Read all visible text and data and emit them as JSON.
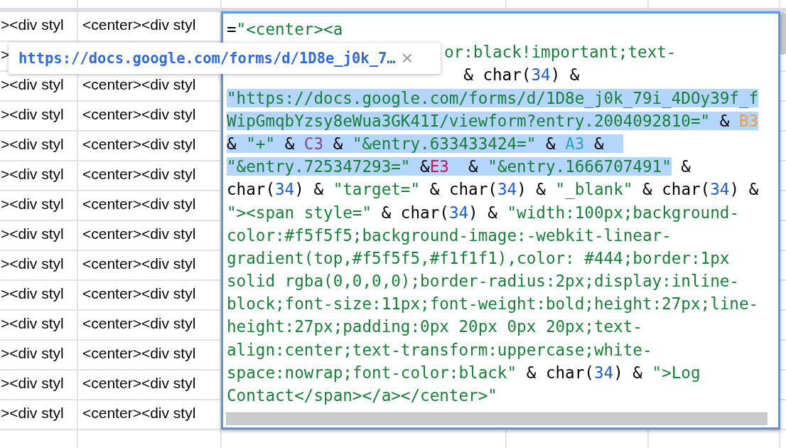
{
  "sheet": {
    "rows": [
      {
        "cells": [
          "><div styl",
          "<center><div styl"
        ]
      },
      {
        "cells": [
          ">"
        ]
      },
      {
        "cells": [
          "><div styl",
          "<center><div styl"
        ]
      },
      {
        "cells": [
          "><div styl",
          "<center><div styl"
        ]
      },
      {
        "cells": [
          "><div styl",
          "<center><div styl"
        ]
      },
      {
        "cells": [
          "><div styl",
          "<center><div styl"
        ]
      },
      {
        "cells": [
          "><div styl",
          "<center><div styl"
        ]
      },
      {
        "cells": [
          "><div styl",
          "<center><div styl"
        ]
      },
      {
        "cells": [
          "><div styl",
          "<center><div styl"
        ]
      },
      {
        "cells": [
          "><div styl",
          "<center><div styl"
        ]
      },
      {
        "cells": [
          "><div styl",
          "<center><div styl"
        ]
      },
      {
        "cells": [
          "><div styl",
          "<center><div styl"
        ]
      },
      {
        "cells": [
          "><div styl",
          "<center><div styl"
        ]
      },
      {
        "cells": [
          "><div styl",
          "<center><div styl"
        ]
      }
    ]
  },
  "editor": {
    "lines": [
      {
        "kind": "full",
        "tokens": [
          {
            "kind": "op",
            "text": "=",
            "selected": false
          },
          {
            "kind": "string",
            "text": "\"<center><a",
            "selected": false
          }
        ]
      },
      {
        "kind": "partial",
        "tokens": [
          {
            "kind": "string",
            "text": "or:black!important;text-",
            "selected": false
          }
        ]
      },
      {
        "kind": "partial",
        "tokens": [
          {
            "kind": "op",
            "text": "  & char(",
            "selected": false
          },
          {
            "kind": "number",
            "text": "34",
            "selected": false
          },
          {
            "kind": "op",
            "text": ") &",
            "selected": false
          }
        ]
      },
      {
        "kind": "full",
        "tokens": [
          {
            "kind": "string",
            "text": "\"https://docs.google.com/forms/d/1D8e_j0k_79i_4DOy39f_f",
            "selected": true
          }
        ]
      },
      {
        "kind": "full",
        "tokens": [
          {
            "kind": "string",
            "text": "WipGmqbYzsy8eWua3GK41I/viewform?entry.2004092810=\"",
            "selected": true
          },
          {
            "kind": "op",
            "text": " & ",
            "selected": true
          },
          {
            "kind": "ref",
            "text": "B3",
            "color": "#f29b35",
            "selected": true
          }
        ]
      },
      {
        "kind": "full",
        "tokens": [
          {
            "kind": "op",
            "text": "& ",
            "selected": true
          },
          {
            "kind": "string",
            "text": "\"+\"",
            "selected": true
          },
          {
            "kind": "op",
            "text": " & ",
            "selected": true
          },
          {
            "kind": "ref",
            "text": "C3",
            "color": "#7e4a8c",
            "selected": true
          },
          {
            "kind": "op",
            "text": " & ",
            "selected": true
          },
          {
            "kind": "string",
            "text": "\"&entry.633433424=\"",
            "selected": true
          },
          {
            "kind": "op",
            "text": " & ",
            "selected": true
          },
          {
            "kind": "ref",
            "text": "A3",
            "color": "#26a5c9",
            "selected": true
          },
          {
            "kind": "op",
            "text": " &  ",
            "selected": true
          }
        ]
      },
      {
        "kind": "full",
        "tokens": [
          {
            "kind": "string",
            "text": "\"&entry.725347293=\"",
            "selected": true
          },
          {
            "kind": "op",
            "text": " &",
            "selected": true
          },
          {
            "kind": "ref",
            "text": "E3",
            "color": "#c2185b",
            "selected": true
          },
          {
            "kind": "op",
            "text": "  & ",
            "selected": true
          },
          {
            "kind": "string",
            "text": "\"&entry.1666707491\"",
            "selected": true
          },
          {
            "kind": "op",
            "text": " &",
            "selected": false
          }
        ]
      },
      {
        "kind": "full",
        "tokens": [
          {
            "kind": "op",
            "text": "char(",
            "selected": false
          },
          {
            "kind": "number",
            "text": "34",
            "selected": false
          },
          {
            "kind": "op",
            "text": ") & ",
            "selected": false
          },
          {
            "kind": "string",
            "text": "\"target=\"",
            "selected": false
          },
          {
            "kind": "op",
            "text": " & char(",
            "selected": false
          },
          {
            "kind": "number",
            "text": "34",
            "selected": false
          },
          {
            "kind": "op",
            "text": ") & ",
            "selected": false
          },
          {
            "kind": "string",
            "text": "\"_blank\"",
            "selected": false
          },
          {
            "kind": "op",
            "text": " & char(",
            "selected": false
          },
          {
            "kind": "number",
            "text": "34",
            "selected": false
          },
          {
            "kind": "op",
            "text": ") &",
            "selected": false
          }
        ]
      },
      {
        "kind": "full",
        "tokens": [
          {
            "kind": "string",
            "text": "\"><span style=\"",
            "selected": false
          },
          {
            "kind": "op",
            "text": " & char(",
            "selected": false
          },
          {
            "kind": "number",
            "text": "34",
            "selected": false
          },
          {
            "kind": "op",
            "text": ") & ",
            "selected": false
          },
          {
            "kind": "string",
            "text": "\"width:100px;background-",
            "selected": false
          }
        ]
      },
      {
        "kind": "full",
        "tokens": [
          {
            "kind": "string",
            "text": "color:#f5f5f5;background-image:-webkit-linear-",
            "selected": false
          }
        ]
      },
      {
        "kind": "full",
        "tokens": [
          {
            "kind": "string",
            "text": "gradient(top,#f5f5f5,#f1f1f1),color: #444;border:1px",
            "selected": false
          }
        ]
      },
      {
        "kind": "full",
        "tokens": [
          {
            "kind": "string",
            "text": "solid rgba(0,0,0,0);border-radius:2px;display:inline-",
            "selected": false
          }
        ]
      },
      {
        "kind": "full",
        "tokens": [
          {
            "kind": "string",
            "text": "block;font-size:11px;font-weight:bold;height:27px;line-",
            "selected": false
          }
        ]
      },
      {
        "kind": "full",
        "tokens": [
          {
            "kind": "string",
            "text": "height:27px;padding:0px 20px 0px 20px;text-",
            "selected": false
          }
        ]
      },
      {
        "kind": "full",
        "tokens": [
          {
            "kind": "string",
            "text": "align:center;text-transform:uppercase;white-",
            "selected": false
          }
        ]
      },
      {
        "kind": "full",
        "tokens": [
          {
            "kind": "string",
            "text": "space:nowrap;font-color:black\"",
            "selected": false
          },
          {
            "kind": "op",
            "text": " & char(",
            "selected": false
          },
          {
            "kind": "number",
            "text": "34",
            "selected": false
          },
          {
            "kind": "op",
            "text": ") & ",
            "selected": false
          },
          {
            "kind": "string",
            "text": "\">Log",
            "selected": false
          }
        ]
      },
      {
        "kind": "full",
        "tokens": [
          {
            "kind": "string",
            "text": "Contact</span></a></center>\"",
            "selected": false
          }
        ]
      }
    ]
  },
  "tooltip": {
    "link": "https://docs.google.com/forms/d/1D8e_j0k_7…",
    "close": "×"
  }
}
